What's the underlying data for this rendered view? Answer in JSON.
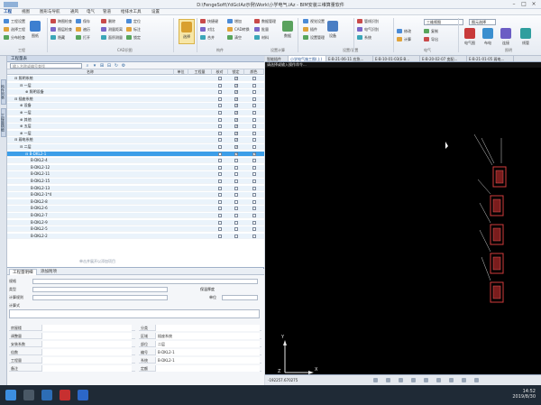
{
  "window": {
    "title": "D:\\FengeSoft\\YdGcIAz示例\\Work\\小学电气.iAz - BIM安装三维算量软件"
  },
  "menu": [
    "工程",
    "视图",
    "图形与导航",
    "通风",
    "电气",
    "管道",
    "给排水工具",
    "设置"
  ],
  "menu_active_index": 0,
  "ribbon": {
    "group_labels": [
      "工程",
      "CAD识图",
      "构件",
      "设置计算",
      "设置/设置",
      "电气",
      "照明"
    ],
    "small_buttons": [
      "工程设置",
      "选择工程",
      "分布检查",
      "跨图检查",
      "图层检查",
      "隐藏",
      "保存",
      "遍历",
      "打开",
      "删除",
      "测量距离",
      "面积测量",
      "定位",
      "标注",
      "锁定",
      "快捷键",
      "对比",
      "合并",
      "增加",
      "CAD转换",
      "清空",
      "数据管理",
      "批量",
      "材料",
      "视觉设置",
      "插件",
      "设置管理",
      "管线识别",
      "电气识别",
      "系统",
      "修改",
      "计算",
      "复制",
      "导出"
    ],
    "big_buttons": [
      "图纸",
      "选择",
      "数据",
      "设备",
      "电气图",
      "布电",
      "连接",
      "线管"
    ],
    "selected_big_index": 1,
    "combo1": "三维视图",
    "combo2": "图元选择"
  },
  "vtabs": [
    "构件列表",
    "工程量明细"
  ],
  "left_panel": {
    "header": "工程量表",
    "search_placeholder": "输入名称或编号查找",
    "columns": [
      "名称",
      "单位",
      "工程量",
      "核对",
      "锁定",
      "颜色"
    ],
    "rows": [
      {
        "name": "⊟ 照明系统",
        "indent": 0,
        "lock": true,
        "color": false,
        "tint": true
      },
      {
        "name": "⊟ 一层",
        "indent": 1,
        "lock": true,
        "color": false,
        "tint": true
      },
      {
        "name": "⊕ 照明设备",
        "indent": 2,
        "lock": true,
        "color": false,
        "tint": true
      },
      {
        "name": "⊟ 插座系统",
        "indent": 0,
        "lock": true,
        "color": false,
        "tint": true
      },
      {
        "name": "⊕ 设备",
        "indent": 1,
        "lock": true,
        "color": false,
        "tint": true
      },
      {
        "name": "⊕ 一层",
        "indent": 1,
        "lock": true,
        "color": false,
        "tint": true
      },
      {
        "name": "⊕ 其他",
        "indent": 1,
        "lock": true,
        "color": false,
        "tint": true
      },
      {
        "name": "⊕ 五层",
        "indent": 1,
        "lock": true,
        "color": false,
        "tint": true
      },
      {
        "name": "⊕ 一层",
        "indent": 1,
        "lock": true,
        "color": false,
        "tint": true
      },
      {
        "name": "⊟ 弱电系统",
        "indent": 0,
        "lock": true,
        "color": false,
        "tint": true
      },
      {
        "name": "⊟ 二层",
        "indent": 1,
        "lock": true,
        "color": false,
        "tint": true
      },
      {
        "name": "⊟ B-DKL2-1",
        "indent": 2,
        "lock": true,
        "color": true,
        "tint": false,
        "selected": true
      },
      {
        "name": "B-DKL2-4",
        "indent": 3,
        "lock": false,
        "color": false,
        "tint": true
      },
      {
        "name": "B-DKL2-12",
        "indent": 3,
        "lock": false,
        "color": false,
        "tint": true
      },
      {
        "name": "B-DKL2-11",
        "indent": 3,
        "lock": false,
        "color": false,
        "tint": true
      },
      {
        "name": "B-DKL2-15",
        "indent": 3,
        "lock": false,
        "color": false,
        "tint": true
      },
      {
        "name": "B-DKL2-13",
        "indent": 3,
        "lock": false,
        "color": false,
        "tint": true
      },
      {
        "name": "B-DKL2-1*4",
        "indent": 3,
        "lock": false,
        "color": false,
        "tint": true
      },
      {
        "name": "B-DKL2-8",
        "indent": 3,
        "lock": false,
        "color": false,
        "tint": true
      },
      {
        "name": "B-DKL2-6",
        "indent": 3,
        "lock": false,
        "color": false,
        "tint": true
      },
      {
        "name": "B-DKL2-7",
        "indent": 3,
        "lock": false,
        "color": false,
        "tint": true
      },
      {
        "name": "B-DKL2-9",
        "indent": 3,
        "lock": false,
        "color": false,
        "tint": true
      },
      {
        "name": "B-DKL2-5",
        "indent": 3,
        "lock": false,
        "color": false,
        "tint": true
      },
      {
        "name": "B-DKL2-2",
        "indent": 3,
        "lock": false,
        "color": false,
        "tint": true
      }
    ],
    "tree_hint": "单击并展开以添加项目"
  },
  "prop_panel": {
    "tabs": [
      "工程量明细",
      "添加附项"
    ],
    "fields": [
      {
        "label": "规格"
      },
      {
        "label": "类型"
      },
      {
        "label": "计算规则"
      },
      {
        "label": "计算式"
      }
    ],
    "extra": {
      "label1": "保温厚度",
      "label2": "单位"
    },
    "grid": [
      {
        "left": "房屋楼",
        "right_label": "分类",
        "right_value": ""
      },
      {
        "left": "调整量",
        "right_label": "区域",
        "right_value": "插座系统"
      },
      {
        "left": "安装系数",
        "right_label": "部位",
        "right_value": "二层"
      },
      {
        "left": "倍数",
        "right_label": "编号",
        "right_value": "B-DKL2-1"
      },
      {
        "left": "工程量",
        "right_label": "系统",
        "right_value": "B-DKL2-1"
      },
      {
        "left": "备注",
        "right_label": "定额",
        "right_value": ""
      }
    ]
  },
  "doc_tabs": [
    "智能插件",
    "小学电气施工图(上)",
    "E-B-21-06-11 应急...",
    "E-B-10-01-03(E-B...",
    "E-B-20-02-07 变配...",
    "E-B-21-01-05 弱电..."
  ],
  "doc_tab_active": 1,
  "command_line": "请选择或输入操作命令...",
  "status": {
    "coord": "-192257.670275"
  },
  "taskbar": {
    "time": "14:52",
    "date": "2019/8/30"
  },
  "colors": {
    "accent": "#1c4f9c",
    "selection": "#3c9ee8",
    "canvas": "#000000",
    "device_red": "#d23b3b"
  }
}
